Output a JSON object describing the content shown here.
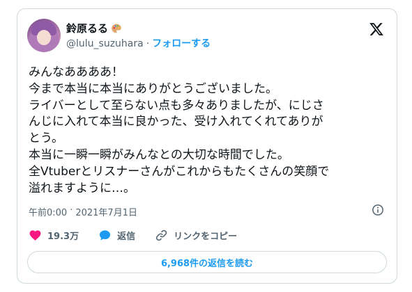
{
  "author": {
    "display_name": "鈴原るる",
    "handle": "@lulu_suzuhara",
    "separator": "·",
    "follow_label": "フォローする"
  },
  "tweet": {
    "lines": [
      "みんなああああ！",
      "今まで本当に本当にありがとうございました。",
      "ライバーとして至らない点も多々ありましたが、にじさ",
      "んじに入れて本当に良かった、受け入れてくれてありが",
      "とう。",
      "本当に一瞬一瞬がみんなとの大切な時間でした。",
      "全Vtuberとリスナーさんがこれからもたくさんの笑顔で",
      "溢れますように…。"
    ],
    "time": "午前0:00",
    "meta_sep": "·",
    "date": "2021年7月1日"
  },
  "actions": {
    "like_count": "19.3万",
    "reply_label": "返信",
    "copy_label": "リンクをコピー"
  },
  "read_replies_label": "6,968件の返信を読む",
  "colors": {
    "accent": "#1d9bf0",
    "like": "#f91880",
    "text": "#0f1419",
    "secondary": "#536471",
    "border": "#cfd9de"
  },
  "icons": [
    "palette-emoji-icon",
    "x-logo-icon",
    "info-icon",
    "heart-icon",
    "reply-bubble-icon",
    "link-icon"
  ]
}
